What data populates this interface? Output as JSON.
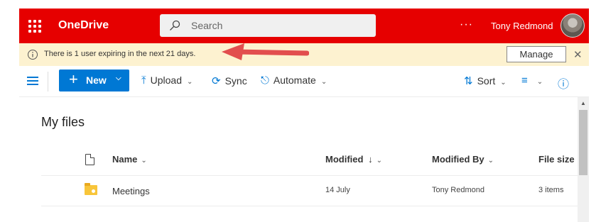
{
  "app": {
    "name": "OneDrive",
    "search_placeholder": "Search",
    "more_label": "···",
    "user_name": "Tony Redmond"
  },
  "notice": {
    "text": "There is 1 user expiring in the next 21 days.",
    "manage_label": "Manage",
    "close_label": "✕"
  },
  "commands": {
    "new_label": "New",
    "upload_label": "Upload",
    "sync_label": "Sync",
    "automate_label": "Automate",
    "sort_label": "Sort"
  },
  "main": {
    "title": "My files",
    "columns": {
      "name": "Name",
      "modified": "Modified",
      "modified_sort": "↓",
      "modified_by": "Modified By",
      "file_size": "File size"
    },
    "rows": [
      {
        "name": "Meetings",
        "modified": "14 July",
        "modified_by": "Tony Redmond",
        "file_size": "3 items"
      }
    ]
  },
  "colors": {
    "brand_red": "#e60000",
    "accent_blue": "#0078d4",
    "notice_bg": "#fdf2d0",
    "annotation_arrow": "#e24e4e"
  }
}
